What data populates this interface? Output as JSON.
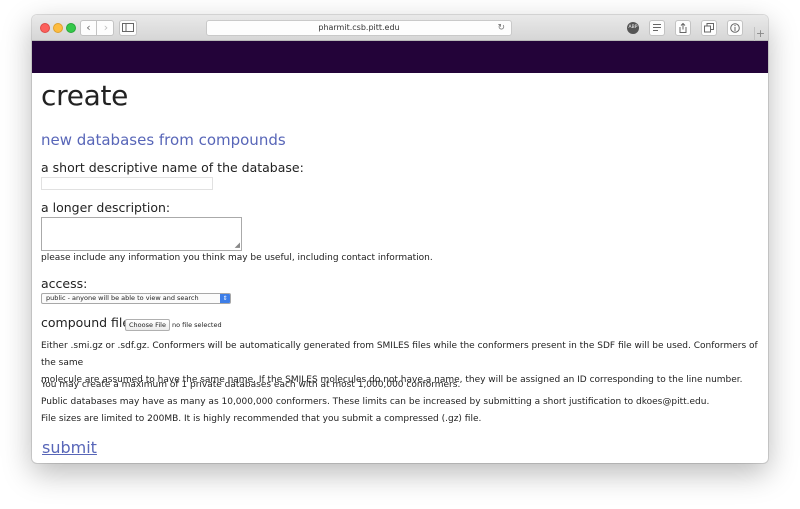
{
  "browser": {
    "url": "pharmit.csb.pitt.edu",
    "nav_back_icon": "‹",
    "nav_forward_icon": "›",
    "reload_icon": "↻",
    "adblock_label": "ABP"
  },
  "colors": {
    "header_bar": "#230339",
    "accent": "#5866b8"
  },
  "page": {
    "title": "create",
    "subtitle": "new databases from compounds",
    "name_label": "a short descriptive name of the database:",
    "name_value": "",
    "description_label": "a longer description:",
    "description_value": "",
    "description_help": "please include any information you think may be useful, including contact information.",
    "access_label": "access:",
    "access_selected": "public - anyone will be able to view and search",
    "compound_file_label": "compound file:",
    "choose_file_label": "Choose File",
    "file_status": "no file selected",
    "format_note_line1": "Either .smi.gz or .sdf.gz. Conformers will be automatically generated from SMILES files while the conformers present in the SDF file will be used. Conformers of the same",
    "format_note_line2": "molecule are assumed to have the same name. If the SMILES molecules do not have a name, they will be assigned an ID corresponding to the line number.",
    "limit_line1": "You may create a maximum of 1 private databases each with at most 1,000,000 conformers.",
    "limit_line2": "Public databases may have as many as 10,000,000 conformers. These limits can be increased by submitting a short justification to dkoes@pitt.edu.",
    "limit_line3": "File sizes are limited to 200MB. It is highly recommended that you submit a compressed (.gz) file.",
    "submit_label": "submit"
  }
}
